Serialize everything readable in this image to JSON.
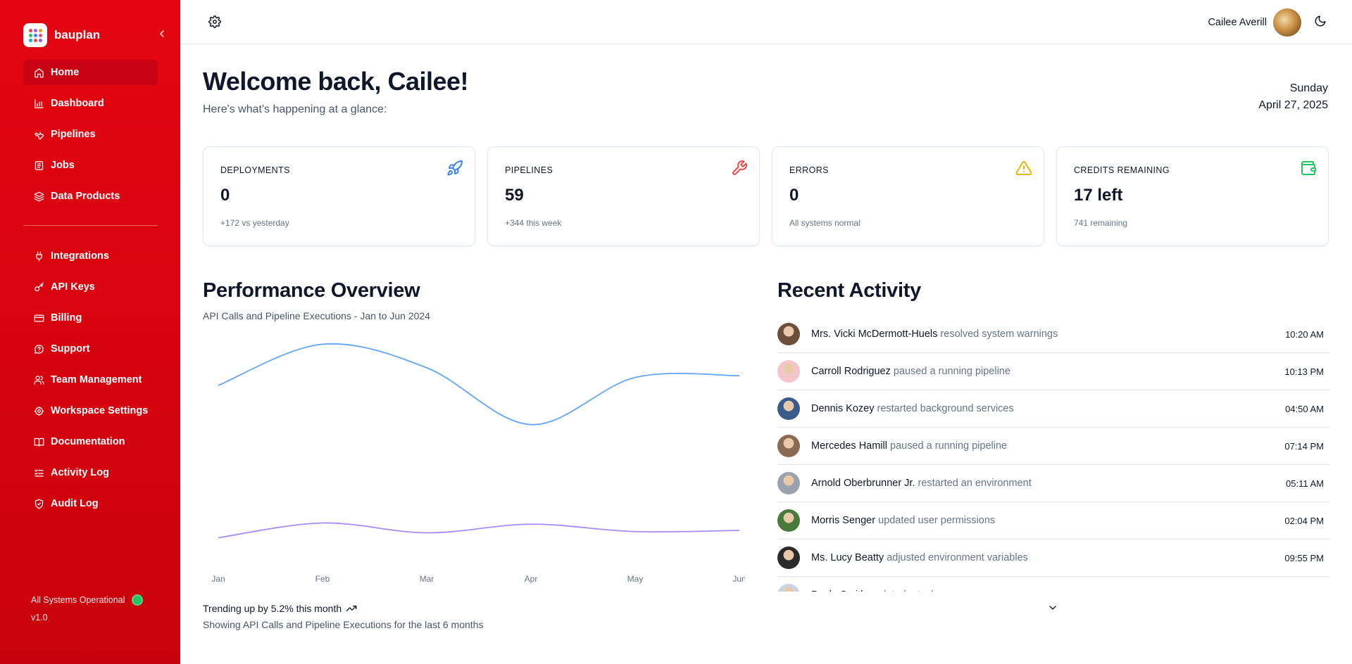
{
  "sidebar": {
    "brand": "bauplan",
    "nav_primary": [
      {
        "label": "Home",
        "icon": "home-icon",
        "active": true
      },
      {
        "label": "Dashboard",
        "icon": "bar-chart-icon"
      },
      {
        "label": "Pipelines",
        "icon": "wrench-icon"
      },
      {
        "label": "Jobs",
        "icon": "briefcase-icon"
      },
      {
        "label": "Data Products",
        "icon": "layers-icon"
      }
    ],
    "nav_secondary": [
      {
        "label": "Integrations",
        "icon": "plug-icon"
      },
      {
        "label": "API Keys",
        "icon": "key-icon"
      },
      {
        "label": "Billing",
        "icon": "credit-card-icon"
      },
      {
        "label": "Support",
        "icon": "chat-icon"
      },
      {
        "label": "Team Management",
        "icon": "users-icon"
      },
      {
        "label": "Workspace Settings",
        "icon": "settings-icon"
      },
      {
        "label": "Documentation",
        "icon": "book-icon"
      },
      {
        "label": "Activity Log",
        "icon": "list-check-icon"
      },
      {
        "label": "Audit Log",
        "icon": "shield-icon"
      }
    ],
    "status_text": "All Systems Operational",
    "version": "v1.0"
  },
  "header": {
    "user_name": "Cailee Averill"
  },
  "main": {
    "welcome": "Welcome back, Cailee!",
    "glance": "Here's what's happening at a glance:",
    "day": "Sunday",
    "date": "April 27, 2025"
  },
  "cards": [
    {
      "label": "DEPLOYMENTS",
      "value": "0",
      "sub": "+172 vs yesterday",
      "icon": "rocket-icon",
      "color": "#3b82f6"
    },
    {
      "label": "PIPELINES",
      "value": "59",
      "sub": "+344 this week",
      "icon": "wrench-icon",
      "color": "#ef4444"
    },
    {
      "label": "ERRORS",
      "value": "0",
      "sub": "All systems normal",
      "icon": "warning-icon",
      "color": "#eab308"
    },
    {
      "label": "CREDITS REMAINING",
      "value": "17 left",
      "sub": "741 remaining",
      "icon": "wallet-icon",
      "color": "#22c55e"
    }
  ],
  "performance": {
    "title": "Performance Overview",
    "subtitle": "API Calls and Pipeline Executions - Jan to Jun 2024",
    "trend_text": "Trending up by 5.2% this month",
    "showing_text": "Showing API Calls and Pipeline Executions for the last 6 months"
  },
  "chart_data": {
    "type": "line",
    "categories": [
      "Jan",
      "Feb",
      "Mar",
      "Apr",
      "May",
      "Jun"
    ],
    "series": [
      {
        "values": [
          186,
          305,
          237,
          73,
          209,
          214
        ],
        "color": "#60a5fa"
      },
      {
        "values": [
          80,
          200,
          120,
          190,
          130,
          140
        ],
        "color": "#a78bfa"
      }
    ],
    "title": "",
    "xlabel": "",
    "ylabel": ""
  },
  "activity": {
    "title": "Recent Activity",
    "items": [
      {
        "name": "Mrs. Vicki McDermott-Huels",
        "action": "resolved system warnings",
        "time": "10:20 AM",
        "avatar_color": "#6b4f3a"
      },
      {
        "name": "Carroll Rodriguez",
        "action": "paused a running pipeline",
        "time": "10:13 PM",
        "avatar_color": "#f4c6cc"
      },
      {
        "name": "Dennis Kozey",
        "action": "restarted background services",
        "time": "04:50 AM",
        "avatar_color": "#3a5c8a"
      },
      {
        "name": "Mercedes Hamill",
        "action": "paused a running pipeline",
        "time": "07:14 PM",
        "avatar_color": "#8a6a52"
      },
      {
        "name": "Arnold Oberbrunner Jr.",
        "action": "restarted an environment",
        "time": "05:11 AM",
        "avatar_color": "#9aa3ad"
      },
      {
        "name": "Morris Senger",
        "action": "updated user permissions",
        "time": "02:04 PM",
        "avatar_color": "#4a7a3a"
      },
      {
        "name": "Ms. Lucy Beatty",
        "action": "adjusted environment variables",
        "time": "09:55 PM",
        "avatar_color": "#2a2a2a"
      },
      {
        "name": "Paula Smith",
        "action": "updated a task",
        "time": "",
        "avatar_color": "#cbd5e1"
      }
    ]
  }
}
